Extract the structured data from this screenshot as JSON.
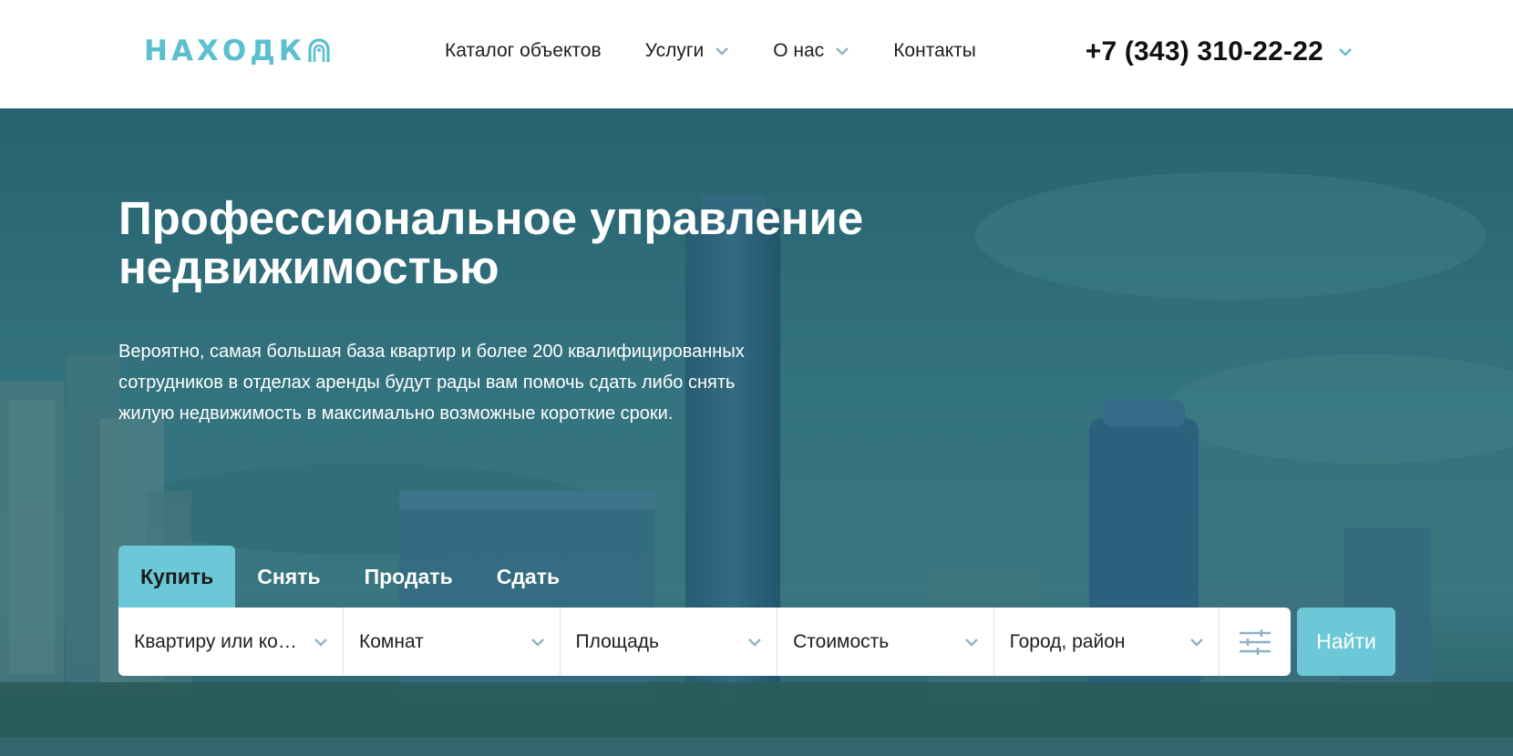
{
  "brand": {
    "logo_text": "НАХОДК",
    "accent": "#5bbfd0"
  },
  "nav": {
    "items": [
      {
        "label": "Каталог объектов",
        "has_dropdown": false
      },
      {
        "label": "Услуги",
        "has_dropdown": true
      },
      {
        "label": "О нас",
        "has_dropdown": true
      },
      {
        "label": "Контакты",
        "has_dropdown": false
      }
    ]
  },
  "phone": {
    "number": "+7 (343) 310-22-22"
  },
  "hero": {
    "title": "Профессиональное управление недвижимостью",
    "description": "Вероятно, самая большая база квартир и более 200 квалифицированных сотрудников в отделах аренды будут рады вам помочь сдать либо снять жилую недвижимость в максимально возможные короткие сроки."
  },
  "search": {
    "tabs": [
      {
        "label": "Купить",
        "active": true
      },
      {
        "label": "Снять",
        "active": false
      },
      {
        "label": "Продать",
        "active": false
      },
      {
        "label": "Сдать",
        "active": false
      }
    ],
    "fields": {
      "type": "Квартиру или комнату",
      "rooms": "Комнат",
      "area": "Площадь",
      "price": "Стоимость",
      "location": "Город, район"
    },
    "submit_label": "Найти",
    "button_color": "#6cc8d6"
  }
}
